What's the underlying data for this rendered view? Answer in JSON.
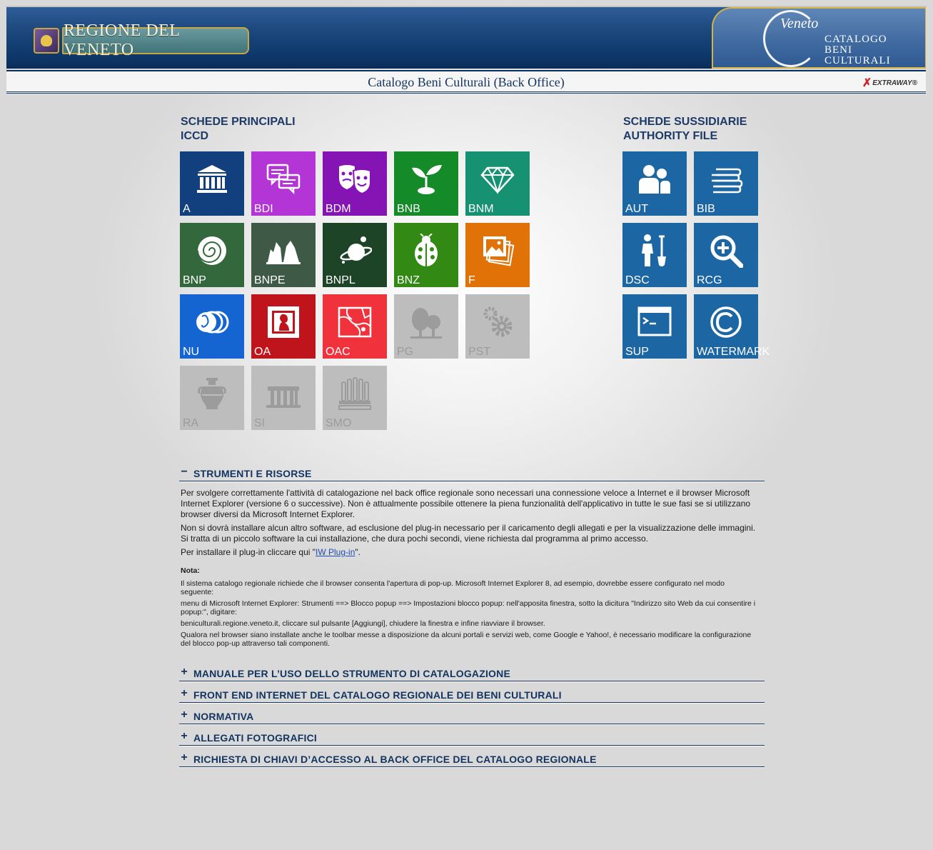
{
  "header": {
    "regione_logo_text": "REGIONE DEL VENETO",
    "cbc_monogram": "Veneto",
    "cbc_lines": [
      "Catalogo",
      "Beni",
      "Culturali"
    ]
  },
  "subbar": {
    "title": "Catalogo Beni Culturali (Back Office)",
    "extraway": "EXTRAWAY®"
  },
  "left_section": {
    "line1": "SCHEDE PRINCIPALI",
    "line2": "ICCD",
    "tiles": [
      {
        "label": "A",
        "icon": "building-icon",
        "color": "#12407e",
        "enabled": true
      },
      {
        "label": "BDI",
        "icon": "chat-bubbles-icon",
        "color": "#b435d6",
        "enabled": true
      },
      {
        "label": "BDM",
        "icon": "theater-masks-icon",
        "color": "#8414b4",
        "enabled": true
      },
      {
        "label": "BNB",
        "icon": "sprout-icon",
        "color": "#148a28",
        "enabled": true
      },
      {
        "label": "BNM",
        "icon": "diamond-icon",
        "color": "#169273",
        "enabled": true
      },
      {
        "label": "BNP",
        "icon": "ammonite-icon",
        "color": "#32683c",
        "enabled": true
      },
      {
        "label": "BNPE",
        "icon": "rocks-icon",
        "color": "#3e5a46",
        "enabled": true
      },
      {
        "label": "BNPL",
        "icon": "planet-icon",
        "color": "#1e4428",
        "enabled": true
      },
      {
        "label": "BNZ",
        "icon": "ladybug-icon",
        "color": "#328a14",
        "enabled": true
      },
      {
        "label": "F",
        "icon": "photos-icon",
        "color": "#e07208",
        "enabled": true
      },
      {
        "label": "NU",
        "icon": "coins-icon",
        "color": "#1464d2",
        "enabled": true
      },
      {
        "label": "OA",
        "icon": "portrait-icon",
        "color": "#c0141c",
        "enabled": true
      },
      {
        "label": "OAC",
        "icon": "map-icon",
        "color": "#f0323c",
        "enabled": true
      },
      {
        "label": "PG",
        "icon": "trees-icon",
        "color": "#bdbdbd",
        "enabled": false
      },
      {
        "label": "PST",
        "icon": "gears-icon",
        "color": "#bdbdbd",
        "enabled": false
      },
      {
        "label": "RA",
        "icon": "amphora-icon",
        "color": "#bdbdbd",
        "enabled": false
      },
      {
        "label": "SI",
        "icon": "temple-icon",
        "color": "#bdbdbd",
        "enabled": false
      },
      {
        "label": "SMO",
        "icon": "organ-icon",
        "color": "#bdbdbd",
        "enabled": false
      }
    ]
  },
  "right_section": {
    "line1": "SCHEDE SUSSIDIARIE",
    "line2": "AUTHORITY FILE",
    "tiles": [
      {
        "label": "AUT",
        "icon": "users-icon",
        "color": "#1c66a4",
        "enabled": true
      },
      {
        "label": "BIB",
        "icon": "books-icon",
        "color": "#1c66a4",
        "enabled": true
      },
      {
        "label": "DSC",
        "icon": "digger-icon",
        "color": "#1c66a4",
        "enabled": true
      },
      {
        "label": "RCG",
        "icon": "zoom-in-icon",
        "color": "#1c66a4",
        "enabled": true
      },
      {
        "label": "SUP",
        "icon": "terminal-icon",
        "color": "#1c66a4",
        "enabled": true
      },
      {
        "label": "WATERMARK",
        "icon": "copyright-icon",
        "color": "#1c66a4",
        "enabled": true
      }
    ]
  },
  "tools": {
    "sign": "−",
    "title": "STRUMENTI E RISORSE",
    "p1": "Per svolgere correttamente l'attività di catalogazione nel back office regionale sono necessari una connessione veloce a Internet e il browser Microsoft Internet Explorer (versione 6 o successive). Non è attualmente possibile ottenere la piena funzionalità dell'applicativo in tutte le sue fasi se si utilizzano browser diversi da Microsoft Internet Explorer.",
    "p2": "Non si dovrà installare alcun altro software, ad esclusione del plug-in necessario per il caricamento degli allegati e per la visualizzazione delle immagini. Si tratta di un piccolo software la cui installazione, che dura pochi secondi, viene richiesta dal programma al primo accesso.",
    "p3_before": "Per installare il plug-in cliccare qui \"",
    "p3_link": "IW Plug-in",
    "p3_after": "\".",
    "nota_title": "Nota:",
    "nota1": "Il sistema catalogo regionale richiede che il browser consenta l'apertura di pop-up. Microsoft Internet Explorer 8, ad esempio, dovrebbe essere configurato nel modo seguente:",
    "nota2": "menu di Microsoft Internet Explorer: Strumenti ==> Blocco popup ==> Impostazioni blocco popup:  nell'apposita finestra, sotto la dicitura \"Indirizzo sito Web da cui consentire i popup:\", digitare:",
    "nota3": "beniculturali.regione.veneto.it, cliccare sul pulsante [Aggiungi], chiudere la finestra e infine riavviare il browser.",
    "nota4": "Qualora nel browser siano installate anche le toolbar messe a disposizione da alcuni portali e servizi web, come Google e Yahoo!, è necessario modificare la configurazione del blocco pop-up attraverso tali componenti."
  },
  "sections": [
    {
      "sign": "+",
      "title": "MANUALE PER L’USO DELLO STRUMENTO DI CATALOGAZIONE"
    },
    {
      "sign": "+",
      "title": "FRONT END INTERNET DEL CATALOGO REGIONALE DEI BENI CULTURALI"
    },
    {
      "sign": "+",
      "title": "NORMATIVA"
    },
    {
      "sign": "+",
      "title": "ALLEGATI FOTOGRAFICI"
    },
    {
      "sign": "+",
      "title": "RICHIESTA DI CHIAVI D’ACCESSO AL BACK OFFICE DEL CATALOGO REGIONALE"
    }
  ]
}
